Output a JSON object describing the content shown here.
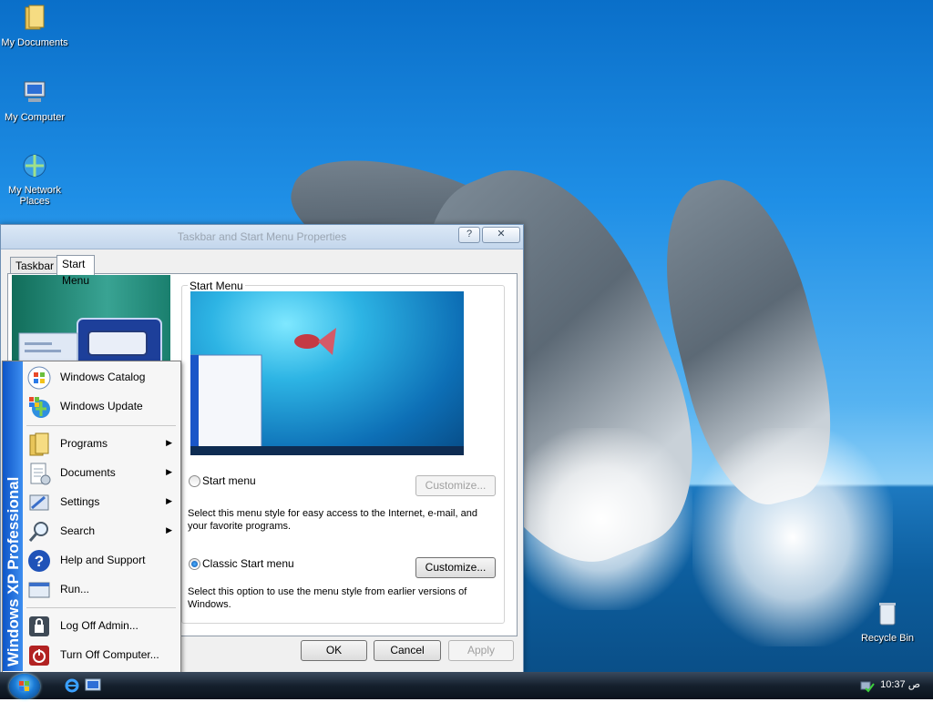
{
  "desktop": {
    "icons": [
      {
        "label": "My Documents"
      },
      {
        "label": "My Computer"
      },
      {
        "label": "My Network Places"
      },
      {
        "label": "Recycle Bin"
      }
    ]
  },
  "dialog": {
    "title": "Taskbar and Start Menu Properties",
    "help_label": "?",
    "close_label": "✕",
    "tabs": [
      {
        "label": "Taskbar"
      },
      {
        "label": "Start Menu"
      }
    ],
    "group_label": "Start Menu",
    "option_start": {
      "label": "Start menu",
      "selected": false,
      "customize_label": "Customize...",
      "description": "Select this menu style for easy access to the Internet, e-mail, and your favorite programs."
    },
    "option_classic": {
      "label": "Classic Start menu",
      "selected": true,
      "customize_label": "Customize...",
      "description": "Select this option to use the menu style from earlier versions of Windows."
    },
    "ok_label": "OK",
    "cancel_label": "Cancel",
    "apply_label": "Apply"
  },
  "start_menu": {
    "banner": "Windows XP Professional",
    "items": [
      {
        "label": "Windows Catalog",
        "icon": "windows-catalog-icon",
        "submenu": false
      },
      {
        "label": "Windows Update",
        "icon": "windows-update-icon",
        "submenu": false
      },
      {
        "label": "Programs",
        "icon": "programs-icon",
        "submenu": true
      },
      {
        "label": "Documents",
        "icon": "documents-icon",
        "submenu": true
      },
      {
        "label": "Settings",
        "icon": "settings-icon",
        "submenu": true
      },
      {
        "label": "Search",
        "icon": "search-icon",
        "submenu": true
      },
      {
        "label": "Help and Support",
        "icon": "help-icon",
        "submenu": false
      },
      {
        "label": "Run...",
        "icon": "run-icon",
        "submenu": false
      },
      {
        "label": "Log Off Admin...",
        "icon": "logoff-icon",
        "submenu": false
      },
      {
        "label": "Turn Off Computer...",
        "icon": "power-icon",
        "submenu": false
      }
    ]
  },
  "taskbar": {
    "clock": "10:37 ص",
    "quicklaunch": [
      "internet-explorer-icon",
      "show-desktop-icon"
    ]
  },
  "colors": {
    "banner": "#1a6ad8",
    "taskbar": "#15202d",
    "accent": "#0a4fa8"
  }
}
